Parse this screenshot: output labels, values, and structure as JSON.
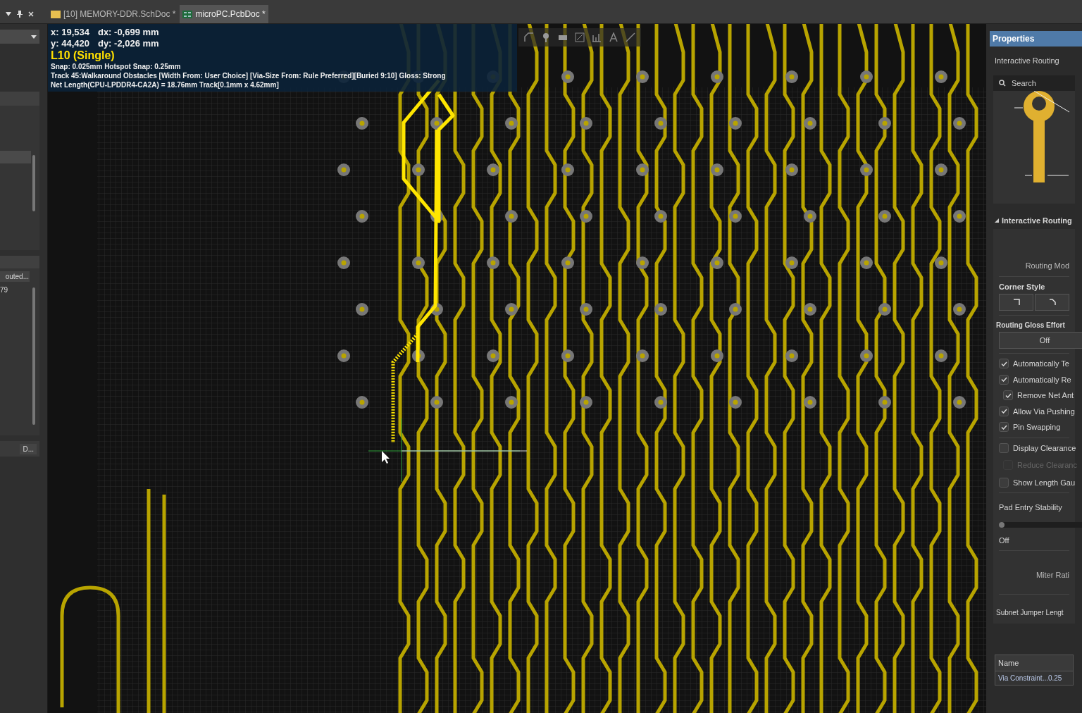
{
  "tabs": [
    {
      "label": "[10] MEMORY-DDR.SchDoc *",
      "kind": "schematic",
      "selected": false
    },
    {
      "label": "microPC.PcbDoc *",
      "kind": "pcb",
      "selected": true
    }
  ],
  "left_panel": {
    "list_item": "outed...",
    "count": "79",
    "button": "D..."
  },
  "hud": {
    "x": "x: 19,534",
    "dx": "dx: -0,699 mm",
    "y": "y: 44,420",
    "dy": "dy: -2,026 mm",
    "layer": "L10 (Single)",
    "lines": [
      "Snap: 0.025mm Hotspot Snap: 0.25mm",
      "Track 45:Walkaround Obstacles [Width From: User Choice] [Via-Size From: Rule Preferred][Buried 9:10] Gloss: Strong",
      "Net Length(CPU-LPDDR4-CA2A) = 18.76mm Track[0.1mm x 4.62mm]"
    ]
  },
  "properties": {
    "title": "Properties",
    "subtitle": "Interactive Routing",
    "search_placeholder": "Search",
    "section": {
      "label": "Interactive Routing",
      "expanded": true
    },
    "routing_mode": "Routing Mod",
    "corner_style": "Corner Style",
    "gloss": {
      "label": "Routing Gloss Effort",
      "value": "Off"
    },
    "options": [
      {
        "label": "Automatically Te",
        "checked": true,
        "disabled": false
      },
      {
        "label": "Automatically Re",
        "checked": true,
        "disabled": false,
        "children": [
          {
            "label": "Remove Net Ant",
            "checked": true,
            "disabled": false
          }
        ]
      },
      {
        "label": "Allow Via Pushing",
        "checked": true,
        "disabled": false
      },
      {
        "label": "Pin Swapping",
        "checked": true,
        "disabled": false
      }
    ],
    "display_options": [
      {
        "label": "Display Clearance",
        "checked": false,
        "disabled": false,
        "children": [
          {
            "label": "Reduce Clearanc",
            "checked": false,
            "disabled": true
          }
        ]
      },
      {
        "label": "Show Length Gau",
        "checked": false,
        "disabled": false
      }
    ],
    "pad_entry": {
      "label": "Pad Entry Stability",
      "level": 0,
      "reading": "Off"
    },
    "miter": "Miter Rati",
    "subnet": "Subnet Jumper Lengt",
    "table": {
      "columns": [
        "Name"
      ],
      "rows": [
        [
          "Via Constraint...0.25"
        ]
      ]
    }
  }
}
